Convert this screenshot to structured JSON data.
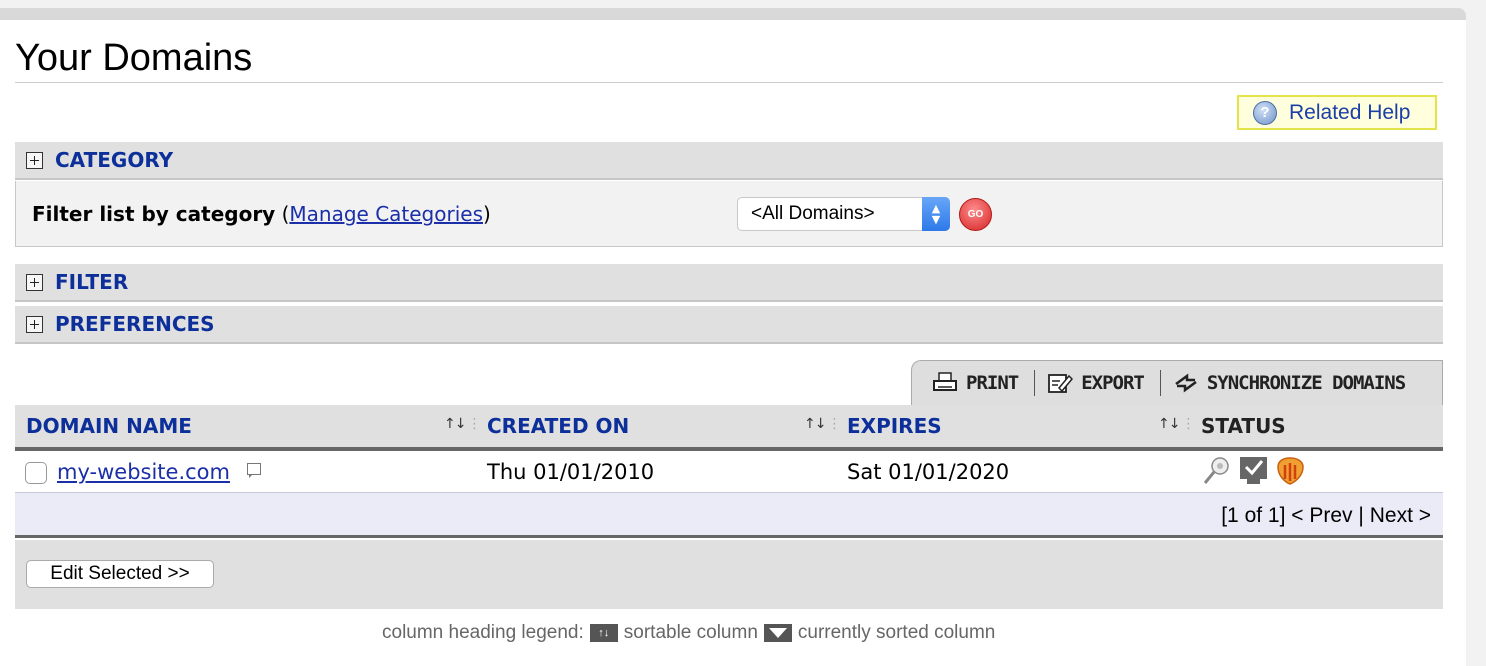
{
  "page": {
    "title": "Your Domains",
    "related_help": "Related Help"
  },
  "sections": {
    "category": "CATEGORY",
    "filter": "FILTER",
    "preferences": "PREFERENCES"
  },
  "category_panel": {
    "filter_label": "Filter list by category",
    "open_paren": "(",
    "manage_link": "Manage Categories",
    "close_paren": ")",
    "select_value": "<All Domains>",
    "go_label": "GO"
  },
  "toolbar": {
    "print": "PRINT",
    "export": "EXPORT",
    "sync": "SYNCHRONIZE DOMAINS"
  },
  "table": {
    "columns": [
      "DOMAIN NAME",
      "CREATED ON",
      "EXPIRES",
      "STATUS"
    ],
    "sort_indicator": "↑↓",
    "rows": [
      {
        "domain": "my-website.com",
        "created": "Thu 01/01/2010",
        "expires": "Sat 01/01/2020",
        "status_icons": [
          "pin-icon",
          "checkmark-icon",
          "shield-icon"
        ]
      }
    ]
  },
  "pager": {
    "range": "[1 of 1]",
    "prev": "< Prev",
    "sep": "|",
    "next": "Next >"
  },
  "actions": {
    "edit_selected": "Edit Selected >>"
  },
  "legend": {
    "prefix": "column heading legend:",
    "sortable": "sortable column",
    "sorted": "currently sorted column"
  },
  "colors": {
    "link_blue": "#1b2fa8",
    "header_blue": "#0c2f9a",
    "panel_gray": "#e0e0e0",
    "help_bg": "#ffffdd",
    "go_red": "#d42424"
  }
}
